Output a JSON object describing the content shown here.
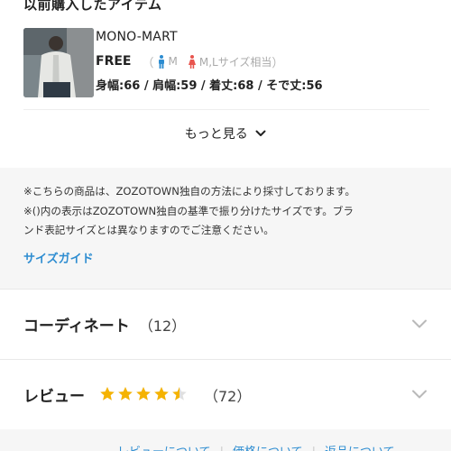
{
  "purchased": {
    "title": "以前購入したアイテム",
    "brand": "MONO-MART",
    "size": "FREE",
    "paren_open": "（",
    "paren_close": "）",
    "men_label": "M",
    "women_label": "M,Lサイズ相当",
    "measurements": "身幅:66 / 肩幅:59 / 着丈:68 / そで丈:56",
    "more_label": "もっと見る"
  },
  "notes": {
    "line1": "※こちらの商品は、ZOZOTOWN独自の方法により採寸しております。",
    "line2": "※()内の表示はZOZOTOWN独自の基準で振り分けたサイズです。ブラ",
    "line3": "ンド表記サイズとは異なりますのでご注意ください。",
    "size_guide": "サイズガイド"
  },
  "coordinate": {
    "label": "コーディネート",
    "count": "（12）"
  },
  "review": {
    "label": "レビュー",
    "rating": 4.5,
    "count": "（72）"
  },
  "footer_links": [
    "レビューについて",
    "価格について",
    "返品について"
  ],
  "colors": {
    "accent_blue": "#2e8dd1",
    "star": "#f5b301",
    "men_icon": "#2e8dd1",
    "women_icon": "#e8554e"
  },
  "icons": {
    "more": "chevron-down-icon",
    "coordinate": "chevron-down-icon",
    "review": "chevron-down-icon",
    "men": "men-icon",
    "women": "women-icon",
    "star": "star-icon"
  }
}
